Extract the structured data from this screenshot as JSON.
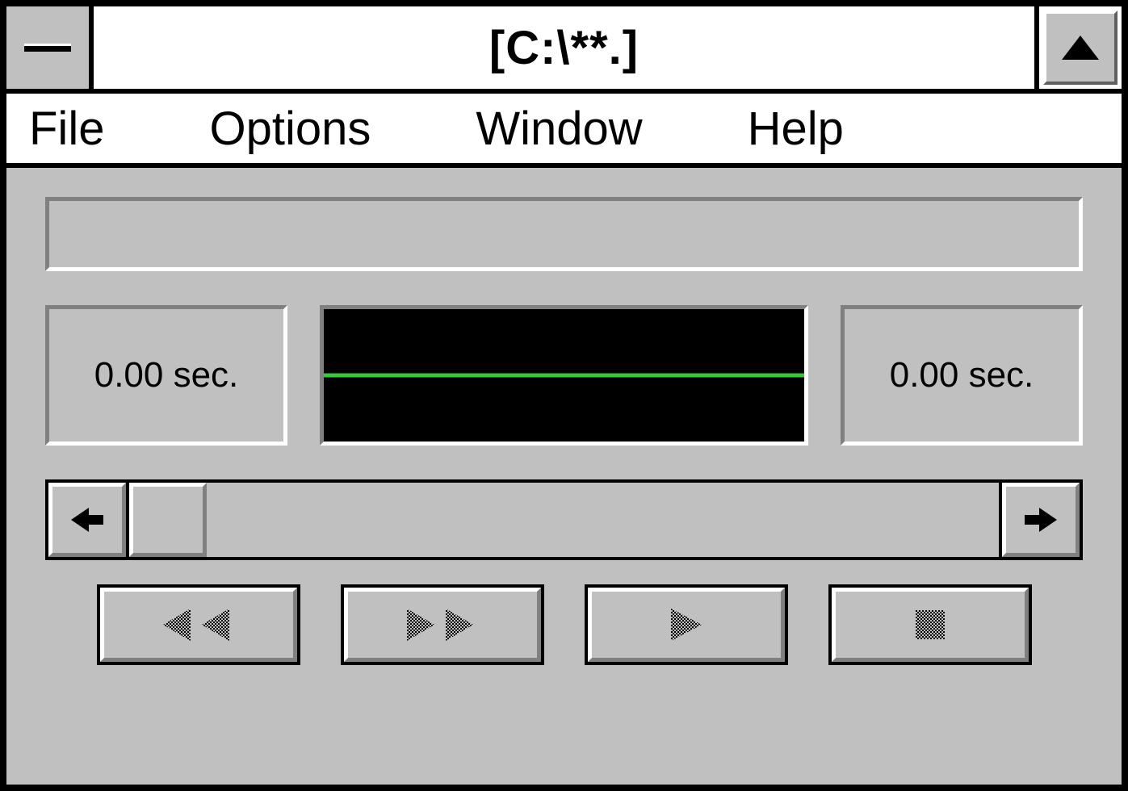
{
  "titlebar": {
    "title": "[C:\\**.]"
  },
  "menu": {
    "items": [
      "File",
      "Options",
      "Window",
      "Help"
    ]
  },
  "status": {
    "position": "0.00 sec.",
    "length": "0.00 sec."
  },
  "icons": {
    "system_menu": "system-menu",
    "maximize": "maximize",
    "scroll_left": "arrow-left",
    "scroll_right": "arrow-right",
    "rewind": "rewind",
    "fast_forward": "fast-forward",
    "play": "play",
    "stop": "stop"
  },
  "colors": {
    "face": "#c0c0c0",
    "waveform": "#38c838",
    "wave_bg": "#000000"
  }
}
